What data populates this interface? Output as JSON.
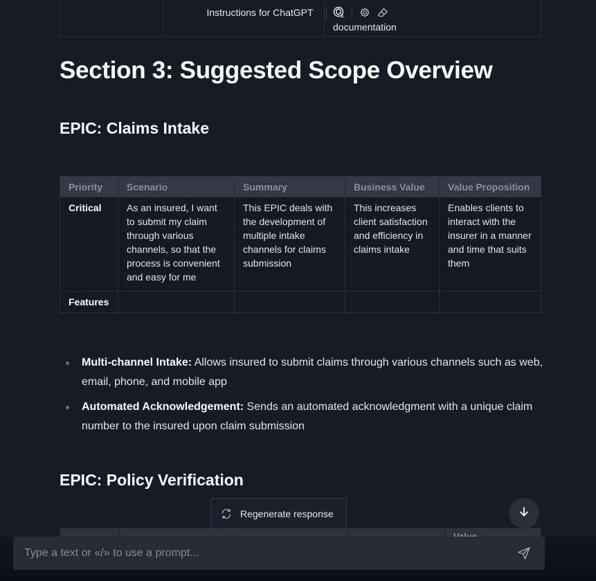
{
  "header": {
    "title": "Instructions for ChatGPT",
    "model_icon": "gpt4-icon",
    "icons": [
      "gear-icon",
      "eraser-icon"
    ]
  },
  "previous_table": {
    "partial_cell_text": "documentation"
  },
  "section": {
    "title": "Section 3: Suggested Scope Overview"
  },
  "epics": [
    {
      "title": "EPIC: Claims Intake",
      "table": {
        "headers": [
          "Priority",
          "Scenario",
          "Summary",
          "Business Value",
          "Value Proposition"
        ],
        "rows": [
          [
            "Critical",
            "As an insured, I want to submit my claim through various channels, so that the process is convenient and easy for me",
            "This EPIC deals with the development of multiple intake channels for claims submission",
            "This increases client satisfaction and efficiency in claims intake",
            "Enables clients to interact with the insurer in a manner and time that suits them"
          ],
          [
            "Features",
            "",
            "",
            "",
            ""
          ]
        ]
      },
      "features": [
        {
          "name": "Multi-channel Intake:",
          "description": " Allows insured to submit claims through various channels such as web, email, phone, and mobile app"
        },
        {
          "name": "Automated Acknowledgement:",
          "description": " Sends an automated acknowledgment with a unique claim number to the insured upon claim submission"
        }
      ]
    },
    {
      "title": "EPIC: Policy Verification",
      "table": {
        "partial_header_text": "Value"
      }
    }
  ],
  "regenerate": {
    "label": "Regenerate response",
    "icon": "refresh-icon"
  },
  "scroll_down": {
    "icon": "arrow-down-icon"
  },
  "composer": {
    "placeholder": "Type a text or «/» to use a prompt...",
    "value": "",
    "send_icon": "send-icon"
  }
}
